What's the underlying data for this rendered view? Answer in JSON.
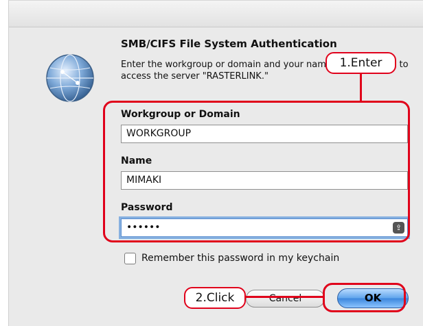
{
  "dialog": {
    "title": "SMB/CIFS File System Authentication",
    "description": "Enter the workgroup or domain and your name and password to access the server \"RASTERLINK.\"",
    "icon": "network-globe-icon"
  },
  "fields": {
    "workgroup": {
      "label": "Workgroup or Domain",
      "value": "WORKGROUP"
    },
    "name": {
      "label": "Name",
      "value": "MIMAKI"
    },
    "password": {
      "label": "Password",
      "value": "••••••"
    }
  },
  "remember": {
    "label": "Remember this password in my keychain",
    "checked": false
  },
  "buttons": {
    "cancel": "Cancel",
    "ok": "OK"
  },
  "annotations": {
    "step1": "1.Enter",
    "step2": "2.Click",
    "color": "#e0001a"
  }
}
